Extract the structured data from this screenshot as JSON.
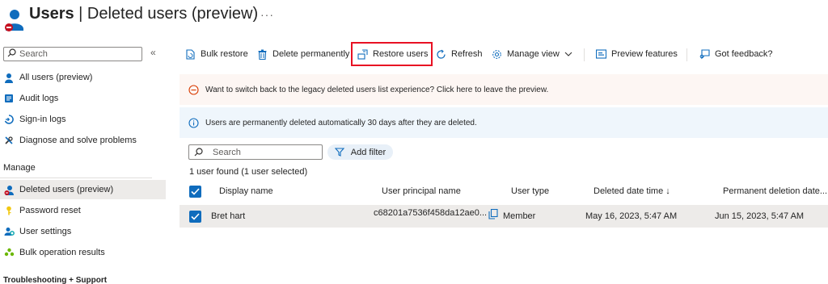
{
  "header": {
    "title_main": "Users",
    "title_separator": " | ",
    "title_sub": "Deleted users (preview)",
    "more_label": "···"
  },
  "sidebar": {
    "search_placeholder": "Search",
    "collapse_label": "«",
    "items": [
      {
        "label": "All users (preview)",
        "icon": "user-icon"
      },
      {
        "label": "Audit logs",
        "icon": "audit-log-icon"
      },
      {
        "label": "Sign-in logs",
        "icon": "sign-in-icon"
      },
      {
        "label": "Diagnose and solve problems",
        "icon": "wrench-icon"
      }
    ],
    "manage_label": "Manage",
    "manage_items": [
      {
        "label": "Deleted users (preview)",
        "icon": "deleted-user-icon",
        "active": true
      },
      {
        "label": "Password reset",
        "icon": "key-icon"
      },
      {
        "label": "User settings",
        "icon": "user-settings-icon"
      },
      {
        "label": "Bulk operation results",
        "icon": "bulk-results-icon"
      }
    ],
    "troubleshooting_label": "Troubleshooting + Support"
  },
  "toolbar": {
    "bulk_restore": "Bulk restore",
    "delete_permanently": "Delete permanently",
    "restore_users": "Restore users",
    "refresh": "Refresh",
    "manage_view": "Manage view",
    "preview_features": "Preview features",
    "got_feedback": "Got feedback?"
  },
  "banners": {
    "warning": "Want to switch back to the legacy deleted users list experience? Click here to leave the preview.",
    "info": "Users are permanently deleted automatically 30 days after they are deleted."
  },
  "filter": {
    "search_placeholder": "Search",
    "add_filter": "Add filter",
    "found_text": "1 user found (1 user selected)"
  },
  "table": {
    "columns": {
      "display_name": "Display name",
      "upn": "User principal name",
      "user_type": "User type",
      "deleted_date": "Deleted date time ↓",
      "perm_deletion": "Permanent deletion date..."
    },
    "rows": [
      {
        "display_name": "Bret hart",
        "upn": "c68201a7536f458da12ae0...",
        "user_type": "Member",
        "deleted_date": "May 16, 2023, 5:47 AM",
        "perm_deletion": "Jun 15, 2023, 5:47 AM",
        "selected": true
      }
    ]
  },
  "colors": {
    "accent": "#0f6cbd",
    "highlight": "#e81123",
    "warning_bg": "#fdf6f3",
    "info_bg": "#eff6fc"
  }
}
